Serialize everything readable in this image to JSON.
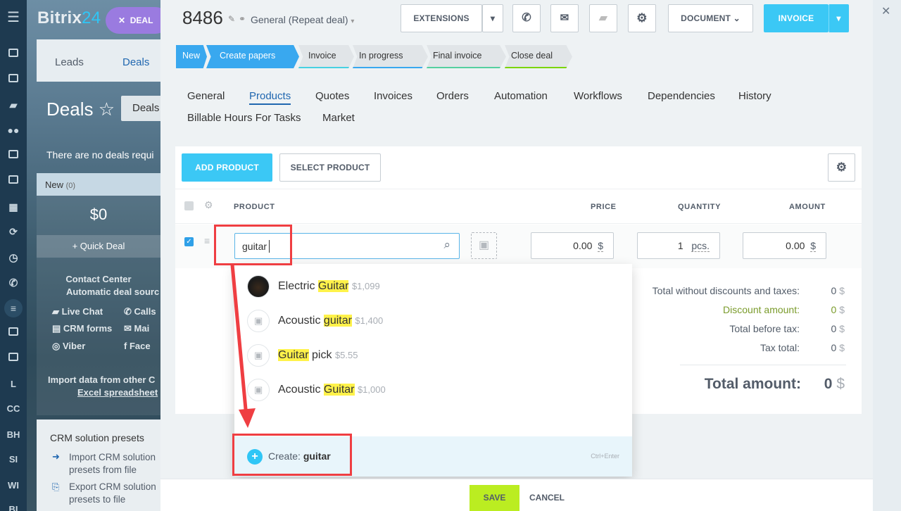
{
  "sidebar": {
    "letters": [
      "L",
      "CC",
      "BH",
      "SI",
      "WI",
      "BI"
    ]
  },
  "background_page": {
    "logo_main": "Bitrix",
    "logo_num": "24",
    "deal_pill": "DEAL",
    "tabs": [
      "Leads",
      "Deals"
    ],
    "title": "Deals",
    "deals_box": "Deals",
    "no_deals": "There are no deals requi",
    "column_name": "New",
    "column_count": "(0)",
    "column_amount": "$0",
    "quick_deal": "+ Quick Deal",
    "contact_center": "Contact Center",
    "auto_source": "Automatic deal sourc",
    "channels": [
      "Live Chat",
      "Calls",
      "CRM forms",
      "Mai",
      "Viber",
      "Face"
    ],
    "import_line1": "Import data from other C",
    "import_line2": "Excel spreadsheet",
    "presets_title": "CRM solution presets",
    "import_preset1": "Import CRM solution",
    "import_preset2": "presets from file",
    "export_preset1": "Export CRM solution",
    "export_preset2": "presets to file"
  },
  "deal": {
    "id": "8486",
    "category": "General (Repeat deal)"
  },
  "toolbar": {
    "extensions": "EXTENSIONS",
    "document": "DOCUMENT",
    "invoice": "INVOICE"
  },
  "stages": [
    {
      "label": "New",
      "color": "#39a8ef"
    },
    {
      "label": "Create papers",
      "color": "#39a8ef"
    },
    {
      "label": "Invoice",
      "color": "#47d1e2"
    },
    {
      "label": "In progress",
      "color": "#39a8ef"
    },
    {
      "label": "Final invoice",
      "color": "#55d0a0"
    },
    {
      "label": "Close deal",
      "color": "#7bd500"
    }
  ],
  "tabs": [
    "General",
    "Products",
    "Quotes",
    "Invoices",
    "Orders",
    "Automation",
    "Workflows",
    "Dependencies",
    "History",
    "Billable Hours For Tasks",
    "Market"
  ],
  "products": {
    "add_product": "ADD PRODUCT",
    "select_product": "SELECT PRODUCT",
    "headers": {
      "product": "PRODUCT",
      "price": "PRICE",
      "quantity": "QUANTITY",
      "amount": "AMOUNT"
    },
    "row": {
      "search_value": "guitar",
      "price": "0.00",
      "price_currency": "$",
      "qty": "1",
      "qty_unit": "pcs.",
      "amount": "0.00",
      "amount_currency": "$"
    }
  },
  "dropdown": {
    "items": [
      {
        "before": "Electric ",
        "match": "Guitar",
        "after": "",
        "price": "$1,099"
      },
      {
        "before": "Acoustic ",
        "match": "guitar",
        "after": "",
        "price": "$1,400"
      },
      {
        "before": "",
        "match": "Guitar",
        "after": " pick",
        "price": "$5.55"
      },
      {
        "before": "Acoustic ",
        "match": "Guitar",
        "after": "",
        "price": "$1,000"
      }
    ],
    "create_label": "Create:",
    "create_value": "guitar",
    "create_hint": "Ctrl+Enter"
  },
  "totals": {
    "without_discount_label": "Total without discounts and taxes:",
    "without_discount_value": "0",
    "discount_label": "Discount amount:",
    "discount_value": "0",
    "before_tax_label": "Total before tax:",
    "before_tax_value": "0",
    "tax_label": "Tax total:",
    "tax_value": "0",
    "currency": "$",
    "total_label": "Total amount:",
    "total_value": "0"
  },
  "footer": {
    "save": "SAVE",
    "cancel": "CANCEL"
  }
}
